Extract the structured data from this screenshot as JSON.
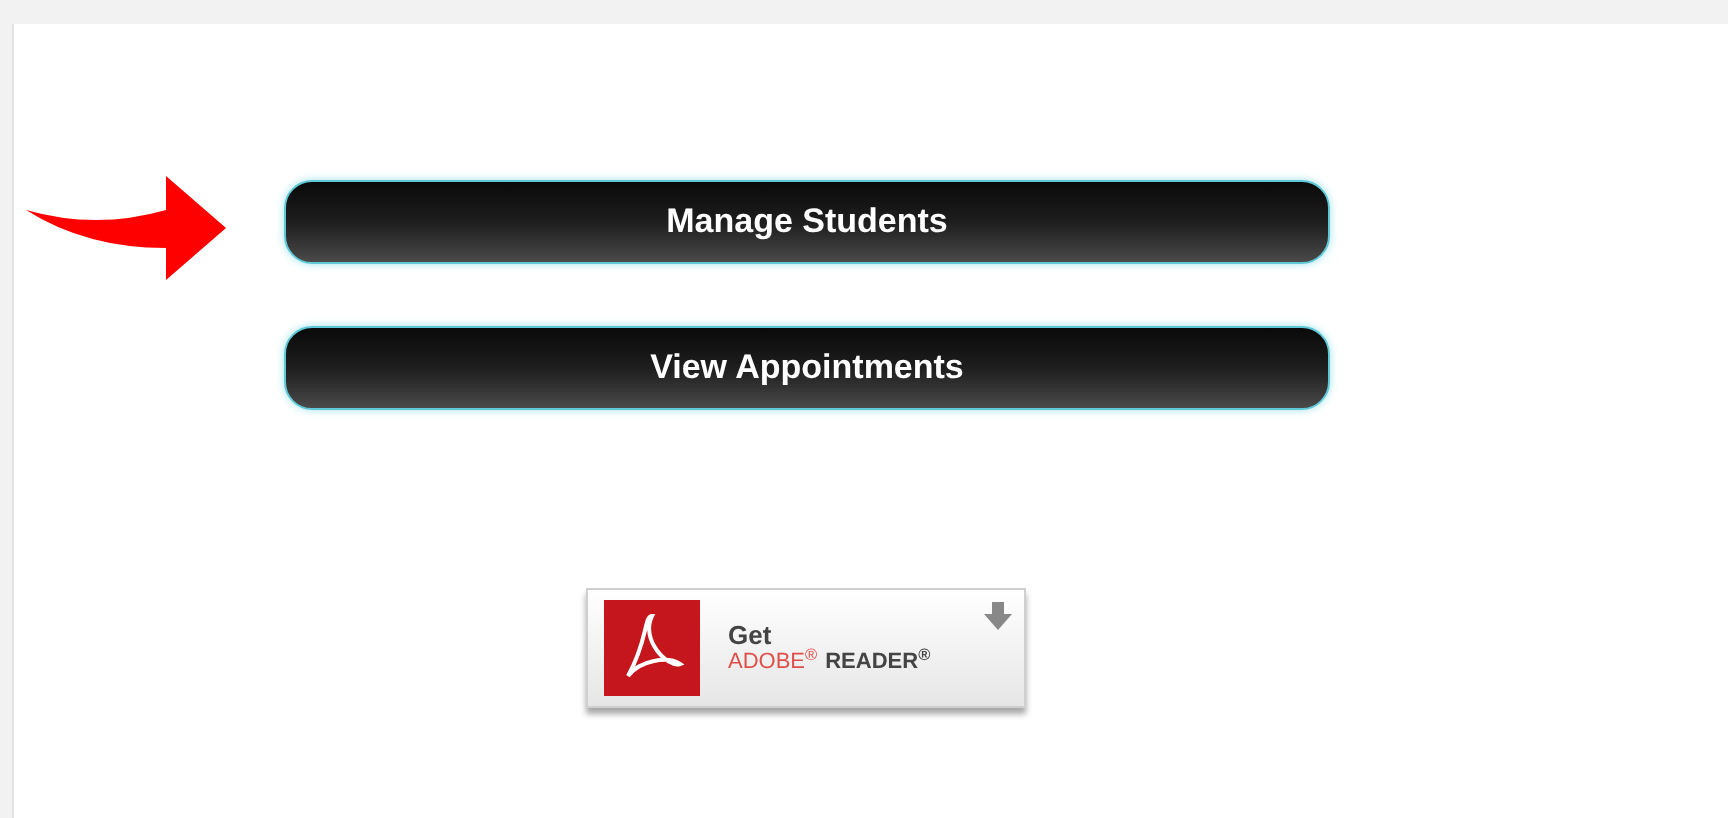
{
  "buttons": [
    {
      "label": "Manage Students"
    },
    {
      "label": "View Appointments"
    }
  ],
  "download_badge": {
    "line_1": "Get",
    "brand": "ADOBE$^{®}$",
    "product": "READER$^{®}$"
  }
}
